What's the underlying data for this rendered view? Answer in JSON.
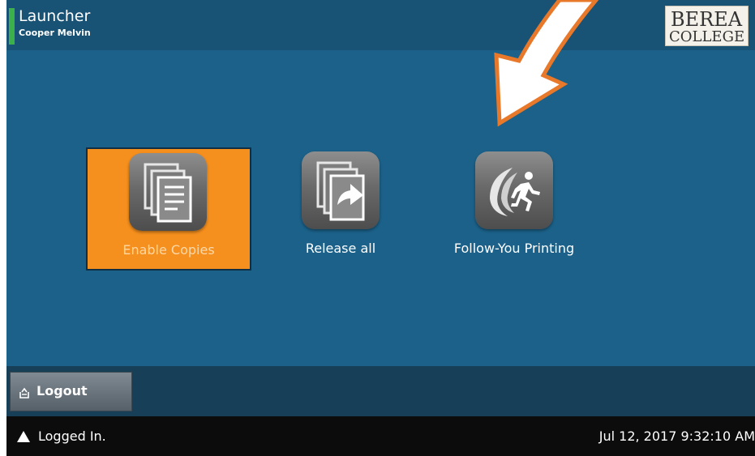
{
  "header": {
    "title": "Launcher",
    "user": "Cooper Melvin",
    "logo_line1": "BEREA",
    "logo_line2": "COLLEGE",
    "status_color": "#3cb04a"
  },
  "tiles": [
    {
      "label": "Enable Copies",
      "icon": "copies-icon",
      "selected": true
    },
    {
      "label": "Release all",
      "icon": "release-all-icon",
      "selected": false
    },
    {
      "label": "Follow-You Printing",
      "icon": "follow-you-printing-icon",
      "selected": false
    }
  ],
  "bottom": {
    "logout_label": "Logout",
    "logout_icon": "logout-icon"
  },
  "status_bar": {
    "status_text": "Logged In.",
    "datetime": "Jul 12, 2017 9:32:10 AM",
    "status_icon": "alert-triangle-icon"
  },
  "annotation": {
    "arrow_color": "#e8782a"
  },
  "colors": {
    "background": "#1b6189",
    "header": "#185275",
    "selected_tile": "#f58f1d",
    "status_bar": "#0c0c0c"
  }
}
